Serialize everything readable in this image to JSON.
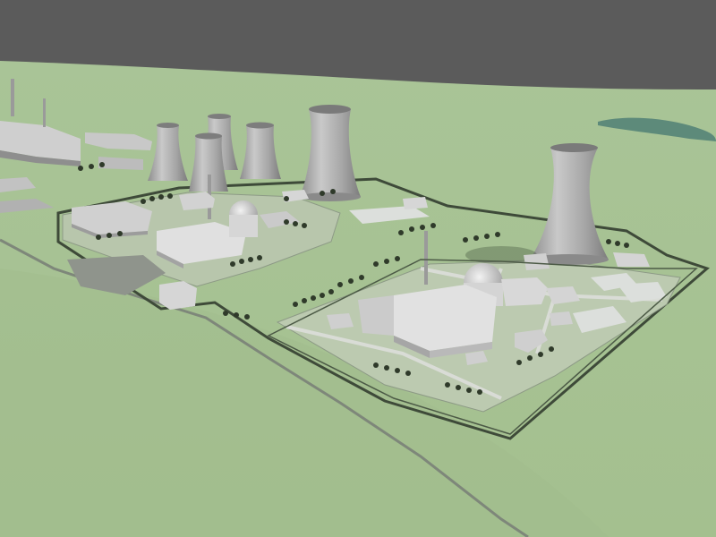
{
  "scene": {
    "colors": {
      "sky": "#5b5b5b",
      "grass": "#a8c494",
      "grass_dark": "#93b080",
      "paving": "#c9cbc9",
      "road": "#9ea39c",
      "concrete": "#d9d9d9",
      "concrete_shadow": "#a9a9a9",
      "tree": "#2f3a2a",
      "water": "#5d8a7a"
    }
  }
}
